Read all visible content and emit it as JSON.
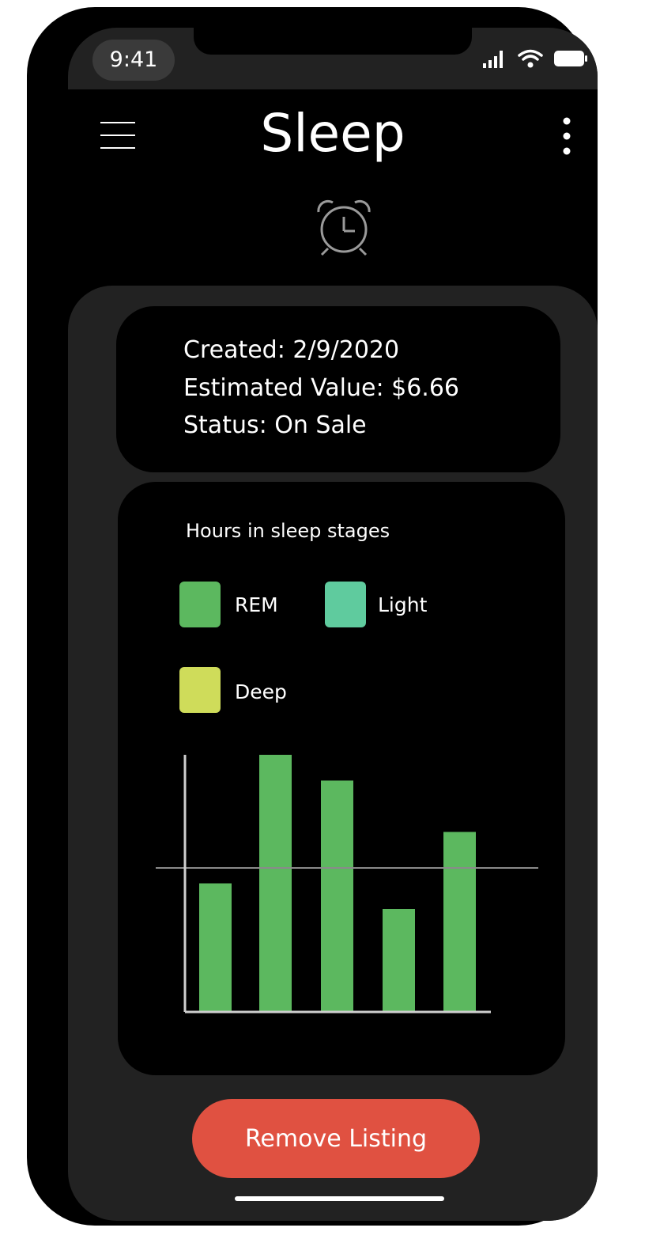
{
  "status_bar": {
    "time": "9:41"
  },
  "header": {
    "title": "Sleep"
  },
  "icons": {
    "menu": "hamburger-menu-icon",
    "more": "more-vertical-icon",
    "alarm": "alarm-clock-icon",
    "signal": "signal-icon",
    "wifi": "wifi-icon",
    "battery": "battery-icon"
  },
  "info": {
    "created": "Created: 2/9/2020",
    "estimated_value": "Estimated Value: $6.66",
    "status": "Status: On Sale"
  },
  "chart_data": {
    "type": "bar",
    "title": "Hours in sleep stages",
    "legend": [
      {
        "label": "REM",
        "color": "#5cb85f"
      },
      {
        "label": "Light",
        "color": "#5fcb9e"
      },
      {
        "label": "Deep",
        "color": "#cfdc5a"
      }
    ],
    "categories": [
      "",
      "",
      "",
      "",
      ""
    ],
    "values": [
      5.0,
      10.0,
      9.0,
      4.0,
      7.0
    ],
    "reference_line": 5.6,
    "ylim": [
      0,
      10
    ],
    "bar_color": "#5cb85f",
    "grid": false
  },
  "actions": {
    "remove_label": "Remove Listing"
  },
  "colors": {
    "background": "#000000",
    "panel": "#222222",
    "accent_button": "#e05141",
    "text": "#ffffff"
  }
}
